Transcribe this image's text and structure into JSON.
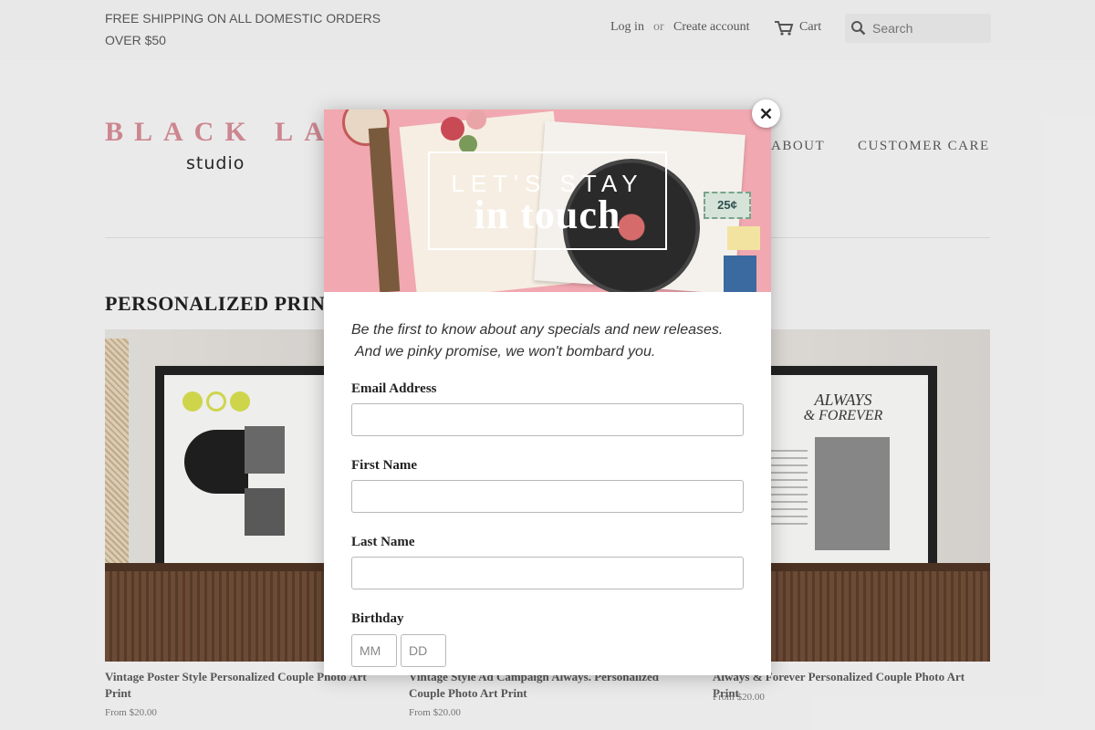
{
  "topbar": {
    "promo": "FREE SHIPPING ON ALL DOMESTIC ORDERS OVER $50",
    "login": "Log in",
    "or": "or",
    "create_account": "Create account",
    "cart": "Cart",
    "search_placeholder": "Search"
  },
  "logo": {
    "top": "BLACK LAB",
    "sub": "studio"
  },
  "nav": {
    "about": "ABOUT",
    "customer_care": "CUSTOMER CARE"
  },
  "collection": {
    "title": "PERSONALIZED PRINTS"
  },
  "products": [
    {
      "title": "Vintage Poster Style Personalized Couple Photo Art Print",
      "price": "From $20.00"
    },
    {
      "title": "Vintage Style Ad Campaign Always. Personalized Couple Photo Art Print",
      "price": "From $20.00"
    },
    {
      "title": "Always & Forever Personalized Couple Photo Art Print",
      "price": "From $20.00"
    }
  ],
  "popup": {
    "hero_line1": "LET'S STAY",
    "hero_line2": "in touch",
    "intro_line1": "Be the first to know about any specials and new releases.",
    "intro_line2": " And we pinky promise, we won't bombard you.",
    "email_label": "Email Address",
    "first_name_label": "First Name",
    "last_name_label": "Last Name",
    "birthday_label": "Birthday",
    "month_placeholder": "MM",
    "day_placeholder": "DD",
    "poster_text_1": "ALWAYS",
    "poster_text_2": "& FOREVER",
    "ticket_price": "25¢"
  },
  "colors": {
    "logo_pink": "#d68a95",
    "hero_pink": "#f1a8b0",
    "background": "#f7f7f7"
  }
}
